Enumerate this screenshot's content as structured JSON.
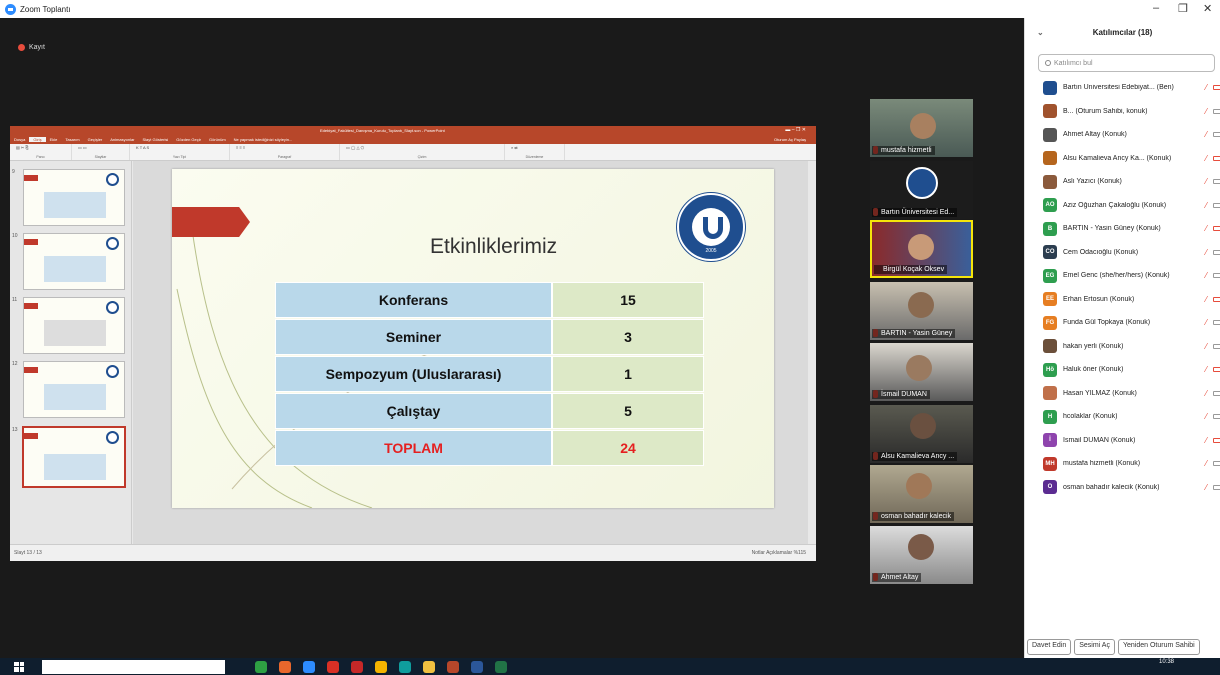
{
  "window": {
    "title": "Zoom Toplantı",
    "minimize": "–",
    "restore": "❐",
    "close": "✕"
  },
  "recording": {
    "label": "Kayıt"
  },
  "ppt": {
    "document_title": "Edebiyat_Fakültesi_Danışma_Kurulu_Toplantı_Slayt.son - PowerPoint",
    "tabs": [
      "Dosya",
      "Giriş",
      "Ekle",
      "Tasarım",
      "Geçişler",
      "Animasyonlar",
      "Slayt Gösterisi",
      "Gözden Geçir",
      "Görünüm",
      "Ne yapmak istediğinizi söyleyin..."
    ],
    "share": "Oturum Aç  Paylaş",
    "ribbon_groups": [
      "Pano",
      "Slaytlar",
      "Yazı Tipi",
      "Paragraf",
      "Çizim",
      "Düzenleme"
    ],
    "thumbnail_numbers": [
      "9",
      "10",
      "11",
      "12",
      "13"
    ],
    "status_left": "Slayt 13 / 13",
    "status_right": "Notlar  Açıklamalar        %115"
  },
  "slide": {
    "title": "Etkinliklerimiz",
    "logo_text": "2005",
    "rows": [
      {
        "label": "Konferans",
        "value": "15"
      },
      {
        "label": "Seminer",
        "value": "3"
      },
      {
        "label": "Sempozyum (Uluslararası)",
        "value": "1"
      },
      {
        "label": "Çalıştay",
        "value": "5"
      }
    ],
    "total": {
      "label": "TOPLAM",
      "value": "24"
    },
    "colors": {
      "label_cell": "#b9d8ea",
      "value_cell": "#dde9c7",
      "total_text": "#e52020",
      "accent": "#c0392b"
    }
  },
  "gallery": [
    {
      "name": "mustafa hizmetli"
    },
    {
      "name": "Bartın Üniversitesi Ed..."
    },
    {
      "name": "Birgül Koçak Oksev"
    },
    {
      "name": "BARTIN -  Yasin Güney"
    },
    {
      "name": "İsmail DUMAN"
    },
    {
      "name": "Alsu Kamalieva Ancy ..."
    },
    {
      "name": "osman bahadır kalecik"
    },
    {
      "name": "Ahmet Altay"
    }
  ],
  "participants": {
    "title": "Katılımcılar (18)",
    "search_placeholder": "Katılımcı bul",
    "list": [
      {
        "initials": "",
        "name": "Bartın Üniversitesi Edebiyat... (Ben)",
        "color": "#1f4e8f"
      },
      {
        "initials": "",
        "name": "B... (Oturum Sahibi, konuk)",
        "color": "#a0522d"
      },
      {
        "initials": "",
        "name": "Ahmet Altay (Konuk)",
        "color": "#555"
      },
      {
        "initials": "",
        "name": "Alsu Kamalieva Ancy Ka... (Konuk)",
        "color": "#b5651d"
      },
      {
        "initials": "",
        "name": "Aslı Yazıcı (Konuk)",
        "color": "#8b5a3c"
      },
      {
        "initials": "AO",
        "name": "Aziz Oğuzhan Çakaloğlu (Konuk)",
        "color": "#2e9e4f"
      },
      {
        "initials": "B",
        "name": "BARTIN -  Yasin Güney (Konuk)",
        "color": "#2e9e4f"
      },
      {
        "initials": "CO",
        "name": "Cem Odacıoğlu (Konuk)",
        "color": "#2c3e50"
      },
      {
        "initials": "EG",
        "name": "Emel Genc (she/her/hers) (Konuk)",
        "color": "#2e9e4f"
      },
      {
        "initials": "EE",
        "name": "Erhan Ertosun (Konuk)",
        "color": "#e67e22"
      },
      {
        "initials": "FG",
        "name": "Funda Gül Topkaya (Konuk)",
        "color": "#e67e22"
      },
      {
        "initials": "",
        "name": "hakan yerli (Konuk)",
        "color": "#6b4f3a"
      },
      {
        "initials": "Hö",
        "name": "Haluk öner (Konuk)",
        "color": "#2e9e4f"
      },
      {
        "initials": "",
        "name": "Hasan YILMAZ (Konuk)",
        "color": "#c0704a"
      },
      {
        "initials": "H",
        "name": "hcolaklar (Konuk)",
        "color": "#2e9e4f"
      },
      {
        "initials": "İ",
        "name": "İsmail DUMAN (Konuk)",
        "color": "#8e44ad"
      },
      {
        "initials": "MH",
        "name": "mustafa hizmetli (Konuk)",
        "color": "#c0392b"
      },
      {
        "initials": "O",
        "name": "osman bahadır kalecik (Konuk)",
        "color": "#5b2c91"
      }
    ],
    "buttons": [
      "Davet Edin",
      "Sesimi Aç",
      "Yeniden Oturum Sahibi"
    ]
  },
  "taskbar": {
    "time": "10:38"
  }
}
